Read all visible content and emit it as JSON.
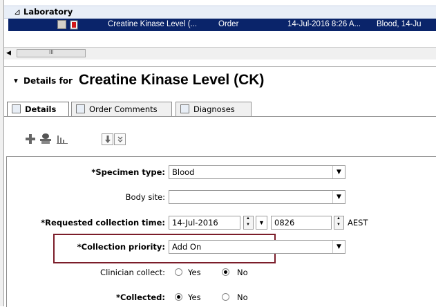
{
  "list": {
    "group_label": "Laboratory",
    "group_toggle_glyph": "⊿",
    "row": {
      "name": "Creatine Kinase Level (...",
      "type": "Order",
      "date": "14-Jul-2016 8:26 A...",
      "details": "Blood, 14-Ju"
    },
    "scroll_grip": "III"
  },
  "details": {
    "collapse_glyph": "▼",
    "prefix": "Details for",
    "title": "Creatine Kinase Level (CK)"
  },
  "tabs": [
    {
      "label": "Details",
      "icon": "details-icon"
    },
    {
      "label": "Order Comments",
      "icon": "comments-icon"
    },
    {
      "label": "Diagnoses",
      "icon": "diagnoses-icon"
    }
  ],
  "toolbar": {
    "icons": [
      "add-icon",
      "remove-icon",
      "chart-icon",
      "move-down-icon",
      "expand-icon"
    ]
  },
  "form": {
    "specimen_type": {
      "label": "*Specimen type:",
      "value": "Blood"
    },
    "body_site": {
      "label": "Body site:",
      "value": ""
    },
    "requested_collection_time": {
      "label": "*Requested collection time:",
      "date": "14-Jul-2016",
      "time": "0826",
      "timezone": "AEST"
    },
    "collection_priority": {
      "label": "*Collection priority:",
      "value": "Add On"
    },
    "clinician_collect": {
      "label": "Clinician collect:",
      "yes": "Yes",
      "no": "No",
      "selected": "No"
    },
    "collected": {
      "label": "*Collected:",
      "yes": "Yes",
      "no": "No",
      "selected": "Yes"
    }
  },
  "colors": {
    "selection": "#0a246a",
    "highlight_box": "#7b1d2a",
    "accent_red": "#d21818"
  }
}
